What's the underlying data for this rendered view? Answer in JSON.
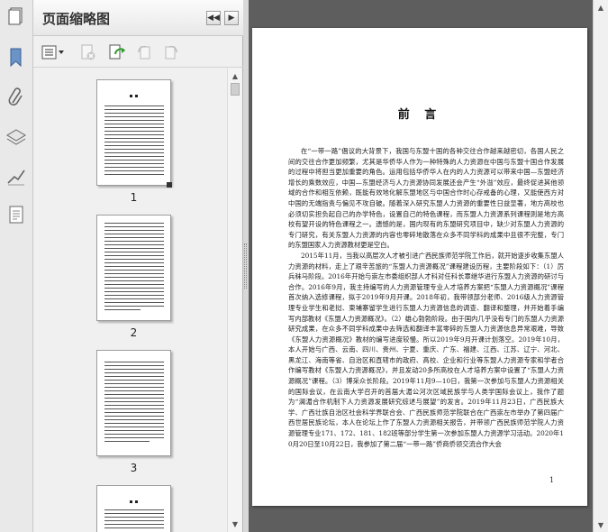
{
  "panel": {
    "title": "页面缩略图",
    "thumbnails": [
      {
        "label": "1"
      },
      {
        "label": "2"
      },
      {
        "label": "3"
      }
    ]
  },
  "page": {
    "heading": "前  言",
    "paragraphs": [
      "在“一带一路”倡议的大背景下，我国与东盟十国的各种交往合作越来越密切，各国人民之间的交往合作更加频繁，尤其是华侨华人作为一种特殊的人力资源在中国与东盟十国合作发展的过程中将担当更加重要的角色。运用包括华侨华人在内的人力资源可以带来中国—东盟经济增长的乘数效应，中国—东盟经济与人力资源协同发展还会产生“外溢”效应，最终促进其他领域的合作和相互依赖，既能有效地化解东盟地区与中国合作时心存戒备的心理，又能使西方对中国的无端指责与偏见不攻自破。随着深入研究东盟人力资源的重要性日益显著，地方高校也必须切实担负起自己的办学特色，设置自己的特色课程，而东盟人力资源系列课程则是地方高校有望开设的特色课程之一。遗憾的是，国内现有的东盟研究项目中，缺少对东盟人力资源的专门研究，有关东盟人力资源的内容也零碎地散落在众多不同学科的成果中且很不完整，专门的东盟国家人力资源教材更是空白。",
      "2015年11月，当我以高层次人才被引进广西民族师范学院工作后，就开始逐步收集东盟人力资源的材料，走上了艰辛苦旅的“东盟人力资源概况”课程建设历程，主要阶段如下：（1）厉兵秣马阶段。2016年开始与崇左市委组织部人才科对任科长覃继华进行东盟人力资源的研讨与合作。2016年9月，我主持编写的人力资源管理专业人才培养方案把“东盟人力资源概况”课程首次纳入选修课程，拟于2019年9月开课。2018年初，我带领部分老师、2016级人力资源管理专业学生和老挝、柬埔寨留学生进行东盟人力资源信息的调查、翻译和整理，并开始着手编写内部教材《东盟人力资源概况》。（2）雄心勃勃阶段。由于国内几乎没有专门的东盟人力资源研究成果，在众多不同学科成果中去筛选和翻译丰富零碎的东盟人力资源信息异常艰难，导致《东盟人力资源概况》教材的编写进度较慢。所以2019年9月开课计划落空。2019年10月，本人开始与广西、云南、四川、贵州、宁夏、重庆、广东、福建、江西、江苏、辽宁、河北、黑龙江、海南等省、自治区和直辖市的政府、高校、企业和行业等东盟人力资源专家和学者合作编写教材《东盟人力资源概况》，并且发动20多所高校在人才培养方案中设置了“东盟人力资源概况”课程。（3）博采众长阶段。2019年11月9—10日，我第一次参加与东盟人力资源相关的国际会议，在云南大学召开的首届大湄公河次区域民族学与人类学国际会议上，我作了题为“澜湄合作机制下人力资源发展研究综述与展望”的发言。2019年11月23日，广西民族大学、广西壮族自治区社会科学界联合会、广西民族师范学院联合在广西崇左市举办了第四届广西世居民族论坛，本人在论坛上作了东盟人力资源相关报告，并带领广西民族师范学院人力资源管理专业171、172、181、182班等部分学生第一次参加东盟人力资源学习活动。2020年10月20日至10月22日，我参加了第二届“一带一路”侨商侨领交流合作大会"
    ],
    "page_number": "1"
  }
}
